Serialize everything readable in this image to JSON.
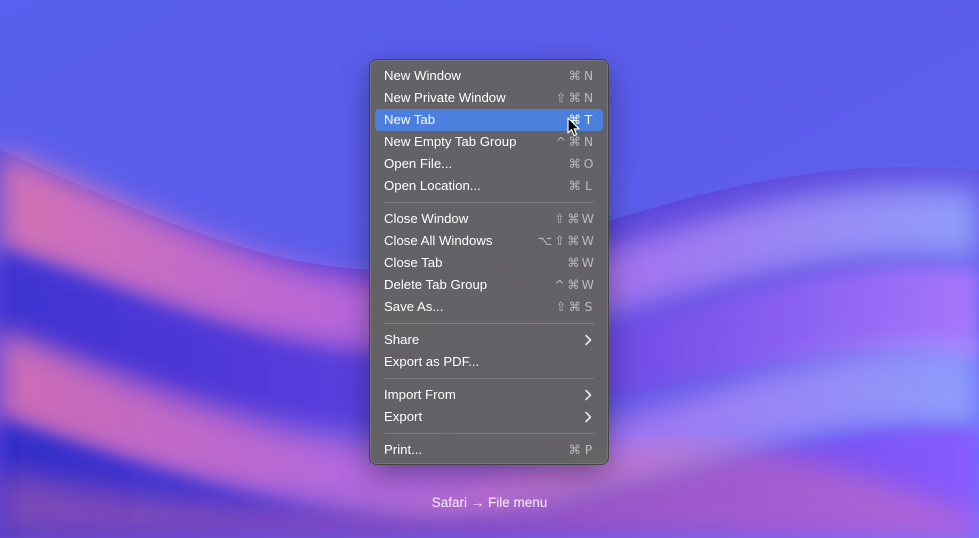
{
  "menu": {
    "sections": [
      {
        "items": [
          {
            "label": "New Window",
            "keys": [
              "⌘",
              "N"
            ]
          },
          {
            "label": "New Private Window",
            "keys": [
              "⇧",
              "⌘",
              "N"
            ]
          },
          {
            "label": "New Tab",
            "keys": [
              "⌘",
              "T"
            ],
            "highlighted": true
          },
          {
            "label": "New Empty Tab Group",
            "keys": [
              "^",
              "⌘",
              "N"
            ]
          },
          {
            "label": "Open File...",
            "keys": [
              "⌘",
              "O"
            ]
          },
          {
            "label": "Open Location...",
            "keys": [
              "⌘",
              "L"
            ]
          }
        ]
      },
      {
        "items": [
          {
            "label": "Close Window",
            "keys": [
              "⇧",
              "⌘",
              "W"
            ]
          },
          {
            "label": "Close All Windows",
            "keys": [
              "⌥",
              "⇧",
              "⌘",
              "W"
            ]
          },
          {
            "label": "Close Tab",
            "keys": [
              "⌘",
              "W"
            ]
          },
          {
            "label": "Delete Tab Group",
            "keys": [
              "^",
              "⌘",
              "W"
            ]
          },
          {
            "label": "Save As...",
            "keys": [
              "⇧",
              "⌘",
              "S"
            ]
          }
        ]
      },
      {
        "items": [
          {
            "label": "Share",
            "submenu": true
          },
          {
            "label": "Export as PDF..."
          }
        ]
      },
      {
        "items": [
          {
            "label": "Import From",
            "submenu": true
          },
          {
            "label": "Export",
            "submenu": true
          }
        ]
      },
      {
        "items": [
          {
            "label": "Print...",
            "keys": [
              "⌘",
              "P"
            ]
          }
        ]
      }
    ]
  },
  "caption": "Safari → File menu",
  "colors": {
    "highlight": "#4a7fdd",
    "menu_bg": "#626262"
  },
  "icons": {
    "submenu": "chevron-right-icon",
    "pointer": "mouse-pointer-icon"
  }
}
